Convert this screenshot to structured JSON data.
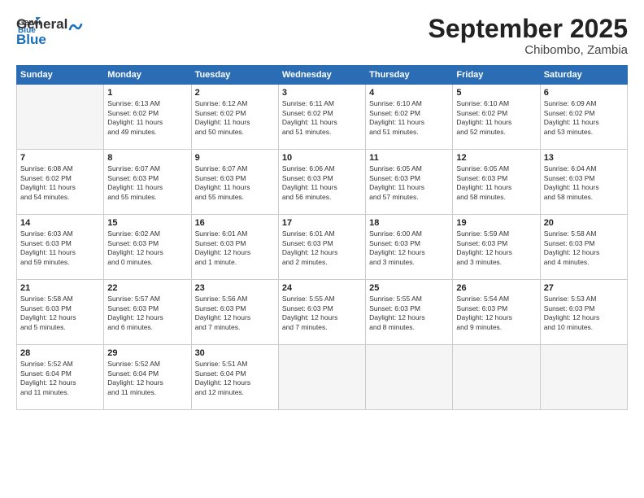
{
  "logo": {
    "line1": "General",
    "line2": "Blue"
  },
  "title": "September 2025",
  "location": "Chibombo, Zambia",
  "headers": [
    "Sunday",
    "Monday",
    "Tuesday",
    "Wednesday",
    "Thursday",
    "Friday",
    "Saturday"
  ],
  "weeks": [
    [
      {
        "day": "",
        "info": ""
      },
      {
        "day": "1",
        "info": "Sunrise: 6:13 AM\nSunset: 6:02 PM\nDaylight: 11 hours\nand 49 minutes."
      },
      {
        "day": "2",
        "info": "Sunrise: 6:12 AM\nSunset: 6:02 PM\nDaylight: 11 hours\nand 50 minutes."
      },
      {
        "day": "3",
        "info": "Sunrise: 6:11 AM\nSunset: 6:02 PM\nDaylight: 11 hours\nand 51 minutes."
      },
      {
        "day": "4",
        "info": "Sunrise: 6:10 AM\nSunset: 6:02 PM\nDaylight: 11 hours\nand 51 minutes."
      },
      {
        "day": "5",
        "info": "Sunrise: 6:10 AM\nSunset: 6:02 PM\nDaylight: 11 hours\nand 52 minutes."
      },
      {
        "day": "6",
        "info": "Sunrise: 6:09 AM\nSunset: 6:02 PM\nDaylight: 11 hours\nand 53 minutes."
      }
    ],
    [
      {
        "day": "7",
        "info": "Sunrise: 6:08 AM\nSunset: 6:02 PM\nDaylight: 11 hours\nand 54 minutes."
      },
      {
        "day": "8",
        "info": "Sunrise: 6:07 AM\nSunset: 6:03 PM\nDaylight: 11 hours\nand 55 minutes."
      },
      {
        "day": "9",
        "info": "Sunrise: 6:07 AM\nSunset: 6:03 PM\nDaylight: 11 hours\nand 55 minutes."
      },
      {
        "day": "10",
        "info": "Sunrise: 6:06 AM\nSunset: 6:03 PM\nDaylight: 11 hours\nand 56 minutes."
      },
      {
        "day": "11",
        "info": "Sunrise: 6:05 AM\nSunset: 6:03 PM\nDaylight: 11 hours\nand 57 minutes."
      },
      {
        "day": "12",
        "info": "Sunrise: 6:05 AM\nSunset: 6:03 PM\nDaylight: 11 hours\nand 58 minutes."
      },
      {
        "day": "13",
        "info": "Sunrise: 6:04 AM\nSunset: 6:03 PM\nDaylight: 11 hours\nand 58 minutes."
      }
    ],
    [
      {
        "day": "14",
        "info": "Sunrise: 6:03 AM\nSunset: 6:03 PM\nDaylight: 11 hours\nand 59 minutes."
      },
      {
        "day": "15",
        "info": "Sunrise: 6:02 AM\nSunset: 6:03 PM\nDaylight: 12 hours\nand 0 minutes."
      },
      {
        "day": "16",
        "info": "Sunrise: 6:01 AM\nSunset: 6:03 PM\nDaylight: 12 hours\nand 1 minute."
      },
      {
        "day": "17",
        "info": "Sunrise: 6:01 AM\nSunset: 6:03 PM\nDaylight: 12 hours\nand 2 minutes."
      },
      {
        "day": "18",
        "info": "Sunrise: 6:00 AM\nSunset: 6:03 PM\nDaylight: 12 hours\nand 3 minutes."
      },
      {
        "day": "19",
        "info": "Sunrise: 5:59 AM\nSunset: 6:03 PM\nDaylight: 12 hours\nand 3 minutes."
      },
      {
        "day": "20",
        "info": "Sunrise: 5:58 AM\nSunset: 6:03 PM\nDaylight: 12 hours\nand 4 minutes."
      }
    ],
    [
      {
        "day": "21",
        "info": "Sunrise: 5:58 AM\nSunset: 6:03 PM\nDaylight: 12 hours\nand 5 minutes."
      },
      {
        "day": "22",
        "info": "Sunrise: 5:57 AM\nSunset: 6:03 PM\nDaylight: 12 hours\nand 6 minutes."
      },
      {
        "day": "23",
        "info": "Sunrise: 5:56 AM\nSunset: 6:03 PM\nDaylight: 12 hours\nand 7 minutes."
      },
      {
        "day": "24",
        "info": "Sunrise: 5:55 AM\nSunset: 6:03 PM\nDaylight: 12 hours\nand 7 minutes."
      },
      {
        "day": "25",
        "info": "Sunrise: 5:55 AM\nSunset: 6:03 PM\nDaylight: 12 hours\nand 8 minutes."
      },
      {
        "day": "26",
        "info": "Sunrise: 5:54 AM\nSunset: 6:03 PM\nDaylight: 12 hours\nand 9 minutes."
      },
      {
        "day": "27",
        "info": "Sunrise: 5:53 AM\nSunset: 6:03 PM\nDaylight: 12 hours\nand 10 minutes."
      }
    ],
    [
      {
        "day": "28",
        "info": "Sunrise: 5:52 AM\nSunset: 6:04 PM\nDaylight: 12 hours\nand 11 minutes."
      },
      {
        "day": "29",
        "info": "Sunrise: 5:52 AM\nSunset: 6:04 PM\nDaylight: 12 hours\nand 11 minutes."
      },
      {
        "day": "30",
        "info": "Sunrise: 5:51 AM\nSunset: 6:04 PM\nDaylight: 12 hours\nand 12 minutes."
      },
      {
        "day": "",
        "info": ""
      },
      {
        "day": "",
        "info": ""
      },
      {
        "day": "",
        "info": ""
      },
      {
        "day": "",
        "info": ""
      }
    ]
  ]
}
